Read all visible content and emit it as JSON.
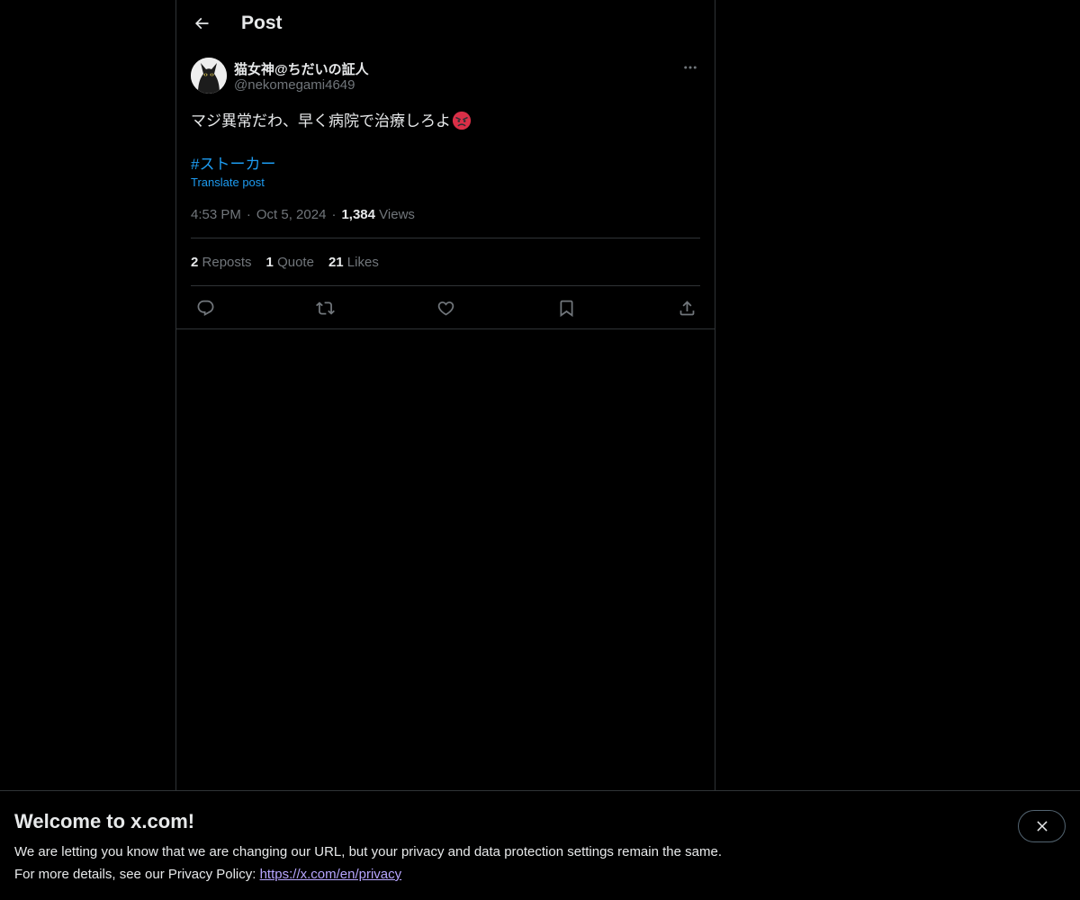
{
  "header": {
    "title": "Post",
    "back_icon": "arrow-left-icon"
  },
  "post": {
    "display_name": "猫女神@ちだいの証人",
    "handle": "@nekomegami4649",
    "text": "マジ異常だわ、早く病院で治療しろよ",
    "emoji": "angry-face-emoji",
    "hashtag": "#ストーカー",
    "translate_label": "Translate post",
    "time": "4:53 PM",
    "date": "Oct 5, 2024",
    "separator": "·",
    "views_count": "1,384",
    "views_label": "Views",
    "stats": [
      {
        "count": "2",
        "label": "Reposts"
      },
      {
        "count": "1",
        "label": "Quote"
      },
      {
        "count": "21",
        "label": "Likes"
      }
    ],
    "actions": [
      "reply-icon",
      "repost-icon",
      "like-icon",
      "bookmark-icon",
      "share-icon"
    ]
  },
  "banner": {
    "title": "Welcome to x.com!",
    "line1": "We are letting you know that we are changing our URL, but your privacy and data protection settings remain the same.",
    "line2_prefix": "For more details, see our Privacy Policy: ",
    "link_text": "https://x.com/en/privacy",
    "close_icon": "close-icon"
  },
  "colors": {
    "background": "#000000",
    "text": "#e7e9ea",
    "muted": "#71767b",
    "accent": "#1d9bf0",
    "divider": "#2f3336",
    "link": "#b7a6ff"
  }
}
